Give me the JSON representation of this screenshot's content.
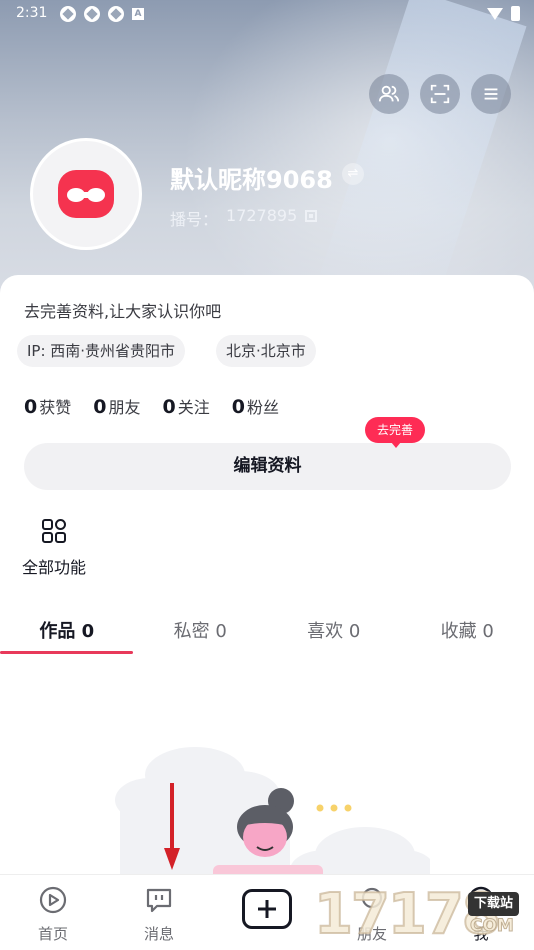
{
  "status_bar": {
    "time": "2:31",
    "notification_icons": [
      "sync-icon",
      "sync-icon",
      "sync-icon",
      "a-icon"
    ]
  },
  "header": {
    "nickname": "默认昵称9068",
    "account_label": "播号：",
    "account_id": "1727895"
  },
  "profile": {
    "bio_prompt": "去完善资料,让大家认识你吧",
    "tags": [
      "IP: 西南·贵州省贵阳市",
      "北京·北京市"
    ],
    "stats": [
      {
        "value": "0",
        "label": "获赞"
      },
      {
        "value": "0",
        "label": "朋友"
      },
      {
        "value": "0",
        "label": "关注"
      },
      {
        "value": "0",
        "label": "粉丝"
      }
    ],
    "complete_badge": "去完善",
    "edit_button": "编辑资料",
    "all_features": "全部功能"
  },
  "tabs": [
    {
      "label": "作品 0",
      "active": true
    },
    {
      "label": "私密 0",
      "active": false
    },
    {
      "label": "喜欢 0",
      "active": false
    },
    {
      "label": "收藏 0",
      "active": false
    }
  ],
  "bottom_nav": {
    "home": "首页",
    "messages": "消息",
    "friends": "朋友",
    "me": "我"
  },
  "watermark": {
    "brand": "1717",
    "mid": "8",
    "download": "下载站",
    "domain": "COM"
  },
  "colors": {
    "accent": "#fe2c55",
    "tab_underline": "#e8395a",
    "arrow": "#d32128"
  }
}
